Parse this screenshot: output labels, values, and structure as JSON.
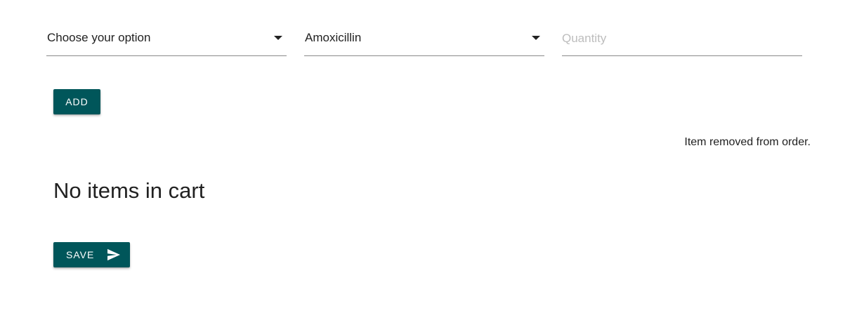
{
  "form": {
    "option_select": {
      "value": "Choose your option"
    },
    "medication_select": {
      "value": "Amoxicillin"
    },
    "quantity": {
      "value": "",
      "placeholder": "Quantity"
    }
  },
  "actions": {
    "add_label": "ADD",
    "save_label": "SAVE"
  },
  "status": {
    "message": "Item removed from order."
  },
  "cart": {
    "empty_text": "No items in cart"
  },
  "colors": {
    "primary_button": "#00565a",
    "text": "#212121",
    "placeholder": "#bdbdbd"
  },
  "icons": {
    "select_caret": "caret-down-icon",
    "save": "send-icon"
  }
}
